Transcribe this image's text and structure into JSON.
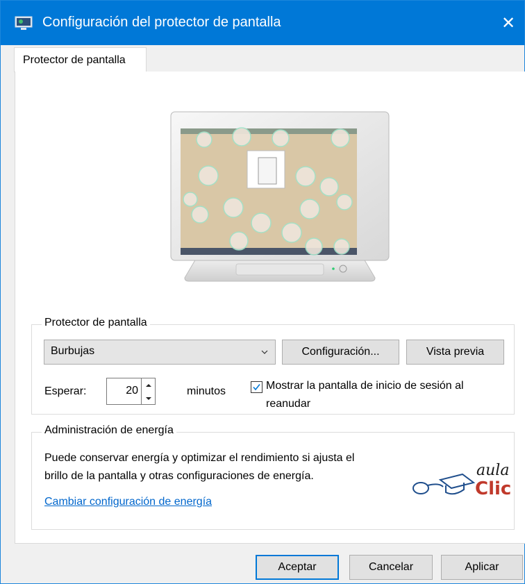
{
  "window": {
    "title": "Configuración del protector de pantalla",
    "close": "✕"
  },
  "tabs": [
    {
      "label": "Protector de pantalla"
    }
  ],
  "screensaver": {
    "group_label": "Protector de pantalla",
    "selected": "Burbujas",
    "settings_button": "Configuración...",
    "preview_button": "Vista previa",
    "wait_label": "Esperar:",
    "wait_value": "20",
    "minutes_label": "minutos",
    "show_logon_checked": true,
    "show_logon_label_line1": "Mostrar la pantalla de inicio de sesión al",
    "show_logon_label_line2": "reanudar"
  },
  "power": {
    "group_label": "Administración de energía",
    "description_line1": "Puede conservar energía y optimizar el rendimiento si ajusta el",
    "description_line2": "brillo de la pantalla y otras configuraciones de energía.",
    "link": "Cambiar configuración de energía"
  },
  "logo": {
    "text1": "aula",
    "text2": "Clic",
    "color": "#c0392b"
  },
  "footer": {
    "ok": "Aceptar",
    "cancel": "Cancelar",
    "apply": "Aplicar"
  },
  "colors": {
    "accent": "#0078d7",
    "link": "#0066cc"
  }
}
